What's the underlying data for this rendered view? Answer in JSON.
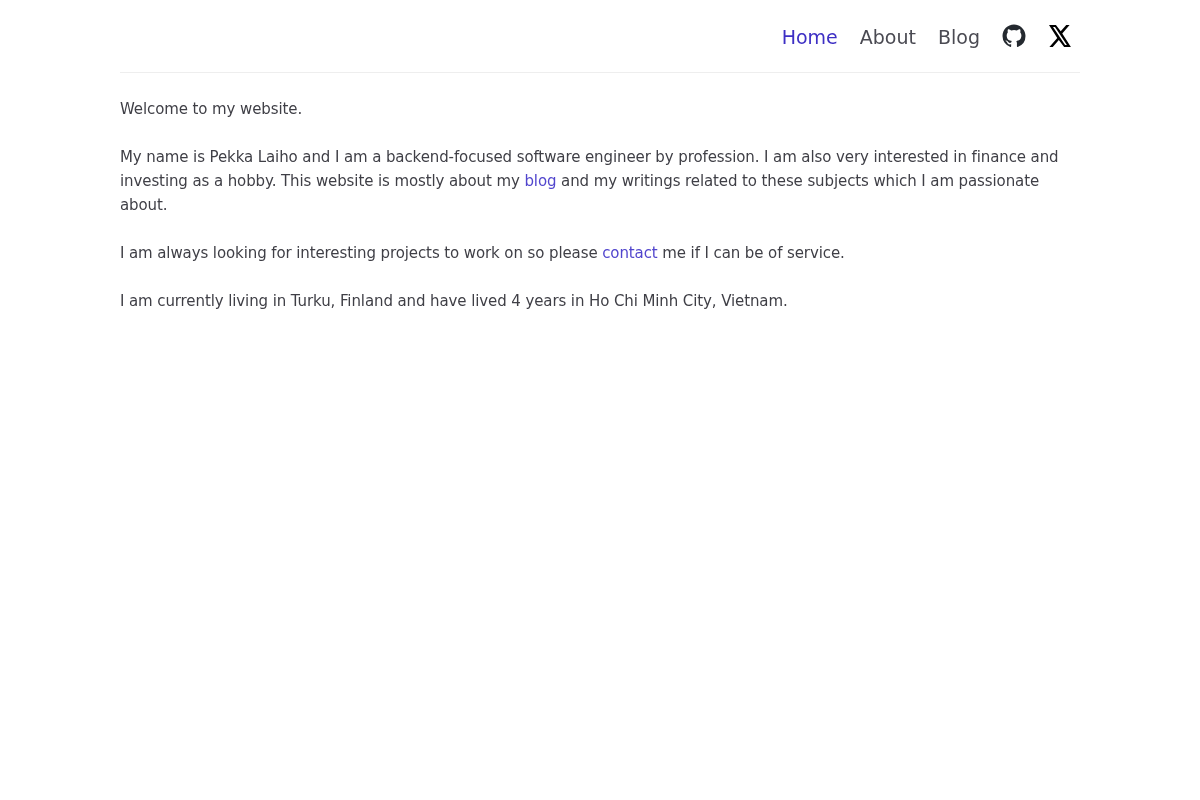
{
  "nav": {
    "links": [
      {
        "label": "Home",
        "selected": true
      },
      {
        "label": "About",
        "selected": false
      },
      {
        "label": "Blog",
        "selected": false
      }
    ],
    "icons": [
      {
        "kind": "github"
      },
      {
        "kind": "x"
      }
    ]
  },
  "paragraphs": [
    [
      {
        "kind": "text",
        "text": "Welcome to my website."
      }
    ],
    [
      {
        "kind": "text",
        "text": "My name is Pekka Laiho and I am a backend-focused software engineer by profession. I am also very interested in finance and investing as a hobby. This website is mostly about my "
      },
      {
        "kind": "link",
        "text": "blog"
      },
      {
        "kind": "text",
        "text": " and my writings related to these subjects which I am passionate about."
      }
    ],
    [
      {
        "kind": "text",
        "text": "I am always looking for interesting projects to work on so please "
      },
      {
        "kind": "link",
        "text": "contact"
      },
      {
        "kind": "text",
        "text": " me if I can be of service."
      }
    ],
    [
      {
        "kind": "text",
        "text": "I am currently living in Turku, Finland and have lived 4 years in Ho Chi Minh City, Vietnam."
      }
    ]
  ]
}
